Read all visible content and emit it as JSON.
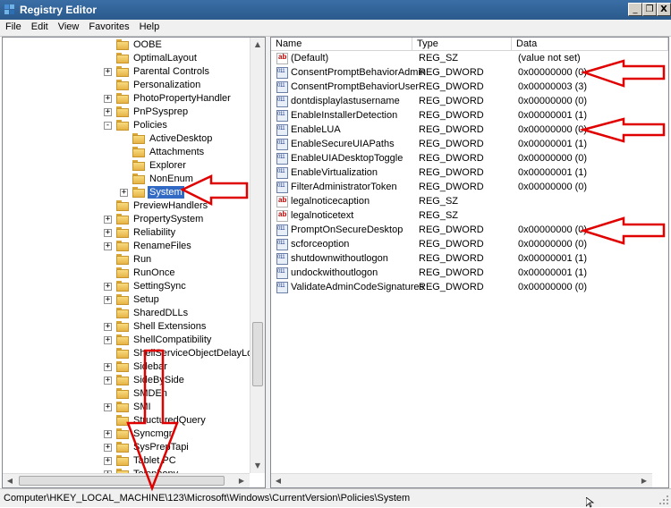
{
  "window": {
    "title": "Registry Editor",
    "minimize_glyph": "_",
    "restore_glyph": "❐",
    "close_glyph": "X"
  },
  "menu": [
    "File",
    "Edit",
    "View",
    "Favorites",
    "Help"
  ],
  "tree": {
    "items": [
      {
        "label": "OOBE",
        "expander": "",
        "depth": 0
      },
      {
        "label": "OptimalLayout",
        "expander": "",
        "depth": 0
      },
      {
        "label": "Parental Controls",
        "expander": "+",
        "depth": 0
      },
      {
        "label": "Personalization",
        "expander": "",
        "depth": 0
      },
      {
        "label": "PhotoPropertyHandler",
        "expander": "+",
        "depth": 0
      },
      {
        "label": "PnPSysprep",
        "expander": "+",
        "depth": 0
      },
      {
        "label": "Policies",
        "expander": "-",
        "depth": 0
      },
      {
        "label": "ActiveDesktop",
        "expander": "",
        "depth": 1
      },
      {
        "label": "Attachments",
        "expander": "",
        "depth": 1
      },
      {
        "label": "Explorer",
        "expander": "",
        "depth": 1
      },
      {
        "label": "NonEnum",
        "expander": "",
        "depth": 1
      },
      {
        "label": "System",
        "expander": "+",
        "depth": 1,
        "selected": true
      },
      {
        "label": "PreviewHandlers",
        "expander": "",
        "depth": 0
      },
      {
        "label": "PropertySystem",
        "expander": "+",
        "depth": 0
      },
      {
        "label": "Reliability",
        "expander": "+",
        "depth": 0
      },
      {
        "label": "RenameFiles",
        "expander": "+",
        "depth": 0
      },
      {
        "label": "Run",
        "expander": "",
        "depth": 0
      },
      {
        "label": "RunOnce",
        "expander": "",
        "depth": 0
      },
      {
        "label": "SettingSync",
        "expander": "+",
        "depth": 0
      },
      {
        "label": "Setup",
        "expander": "+",
        "depth": 0
      },
      {
        "label": "SharedDLLs",
        "expander": "",
        "depth": 0
      },
      {
        "label": "Shell Extensions",
        "expander": "+",
        "depth": 0
      },
      {
        "label": "ShellCompatibility",
        "expander": "+",
        "depth": 0
      },
      {
        "label": "ShellServiceObjectDelayLoad",
        "expander": "",
        "depth": 0
      },
      {
        "label": "Sidebar",
        "expander": "+",
        "depth": 0
      },
      {
        "label": "SideBySide",
        "expander": "+",
        "depth": 0
      },
      {
        "label": "SMDEn",
        "expander": "",
        "depth": 0
      },
      {
        "label": "SMI",
        "expander": "+",
        "depth": 0
      },
      {
        "label": "StructuredQuery",
        "expander": "",
        "depth": 0
      },
      {
        "label": "Syncmgr",
        "expander": "+",
        "depth": 0
      },
      {
        "label": "SysPrepTapi",
        "expander": "+",
        "depth": 0
      },
      {
        "label": "Tablet PC",
        "expander": "+",
        "depth": 0
      },
      {
        "label": "Telephony",
        "expander": "+",
        "depth": 0
      }
    ]
  },
  "list": {
    "columns": [
      "Name",
      "Type",
      "Data"
    ],
    "rows": [
      {
        "icon": "string-value-icon",
        "name": "(Default)",
        "type": "REG_SZ",
        "data": "(value not set)"
      },
      {
        "icon": "dword-value-icon",
        "name": "ConsentPromptBehaviorAdmin",
        "type": "REG_DWORD",
        "data": "0x00000000 (0)"
      },
      {
        "icon": "dword-value-icon",
        "name": "ConsentPromptBehaviorUser",
        "type": "REG_DWORD",
        "data": "0x00000003 (3)"
      },
      {
        "icon": "dword-value-icon",
        "name": "dontdisplaylastusername",
        "type": "REG_DWORD",
        "data": "0x00000000 (0)"
      },
      {
        "icon": "dword-value-icon",
        "name": "EnableInstallerDetection",
        "type": "REG_DWORD",
        "data": "0x00000001 (1)"
      },
      {
        "icon": "dword-value-icon",
        "name": "EnableLUA",
        "type": "REG_DWORD",
        "data": "0x00000000 (0)"
      },
      {
        "icon": "dword-value-icon",
        "name": "EnableSecureUIAPaths",
        "type": "REG_DWORD",
        "data": "0x00000001 (1)"
      },
      {
        "icon": "dword-value-icon",
        "name": "EnableUIADesktopToggle",
        "type": "REG_DWORD",
        "data": "0x00000000 (0)"
      },
      {
        "icon": "dword-value-icon",
        "name": "EnableVirtualization",
        "type": "REG_DWORD",
        "data": "0x00000001 (1)"
      },
      {
        "icon": "dword-value-icon",
        "name": "FilterAdministratorToken",
        "type": "REG_DWORD",
        "data": "0x00000000 (0)"
      },
      {
        "icon": "string-value-icon",
        "name": "legalnoticecaption",
        "type": "REG_SZ",
        "data": ""
      },
      {
        "icon": "string-value-icon",
        "name": "legalnoticetext",
        "type": "REG_SZ",
        "data": ""
      },
      {
        "icon": "dword-value-icon",
        "name": "PromptOnSecureDesktop",
        "type": "REG_DWORD",
        "data": "0x00000000 (0)"
      },
      {
        "icon": "dword-value-icon",
        "name": "scforceoption",
        "type": "REG_DWORD",
        "data": "0x00000000 (0)"
      },
      {
        "icon": "dword-value-icon",
        "name": "shutdownwithoutlogon",
        "type": "REG_DWORD",
        "data": "0x00000001 (1)"
      },
      {
        "icon": "dword-value-icon",
        "name": "undockwithoutlogon",
        "type": "REG_DWORD",
        "data": "0x00000001 (1)"
      },
      {
        "icon": "dword-value-icon",
        "name": "ValidateAdminCodeSignatures",
        "type": "REG_DWORD",
        "data": "0x00000000 (0)"
      }
    ]
  },
  "statusbar": {
    "path": "Computer\\HKEY_LOCAL_MACHINE\\123\\Microsoft\\Windows\\CurrentVersion\\Policies\\System"
  },
  "colors": {
    "selection": "#316ac5",
    "annotation_red": "#e00000",
    "titlebar": "#2b5a8c"
  }
}
